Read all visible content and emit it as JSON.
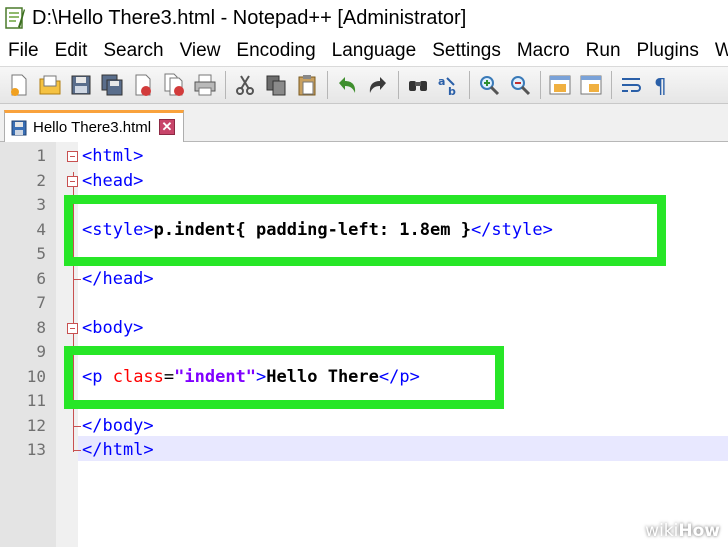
{
  "window": {
    "title": "D:\\Hello There3.html - Notepad++ [Administrator]"
  },
  "menu": {
    "items": [
      "File",
      "Edit",
      "Search",
      "View",
      "Encoding",
      "Language",
      "Settings",
      "Macro",
      "Run",
      "Plugins",
      "Win"
    ]
  },
  "toolbar": {
    "icons": [
      "new-file-icon",
      "open-file-icon",
      "save-icon",
      "save-all-icon",
      "close-icon",
      "close-all-icon",
      "print-icon",
      "cut-icon",
      "copy-icon",
      "paste-icon",
      "undo-icon",
      "redo-icon",
      "find-icon",
      "replace-icon",
      "zoom-in-icon",
      "zoom-out-icon",
      "sync-vertical-icon",
      "sync-horizontal-icon",
      "word-wrap-icon",
      "show-all-chars-icon"
    ]
  },
  "tab": {
    "label": "Hello There3.html",
    "close_glyph": "✕"
  },
  "editor": {
    "line_numbers": [
      "1",
      "2",
      "3",
      "4",
      "5",
      "6",
      "7",
      "8",
      "9",
      "10",
      "11",
      "12",
      "13"
    ],
    "lines": {
      "l1": "<html>",
      "l2": "<head>",
      "l4_open": "<style>",
      "l4_text": "p.indent{ padding-left: 1.8em }",
      "l4_close": "</style>",
      "l6": "</head>",
      "l8": "<body>",
      "l10_open_start": "<p ",
      "l10_attr": "class",
      "l10_eq": "=",
      "l10_str": "\"indent\"",
      "l10_open_end": ">",
      "l10_text": "Hello There",
      "l10_close": "</p>",
      "l12": "</body>",
      "l13": "</html>"
    }
  },
  "colors": {
    "highlight_green": "#27e627",
    "tag_blue": "#0000ff",
    "attr_red": "#ff0000",
    "string_purple": "#8000ff",
    "tab_accent": "#f9a23c"
  },
  "watermark": {
    "prefix": "wiki",
    "suffix": "How"
  }
}
